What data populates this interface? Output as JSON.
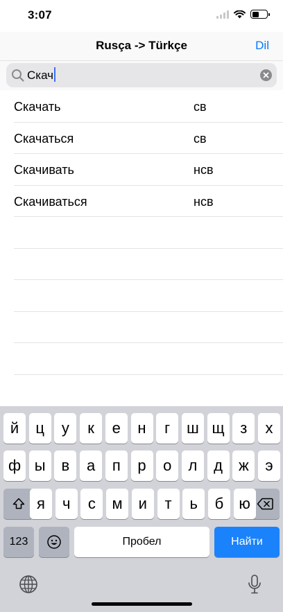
{
  "status_bar": {
    "time": "3:07"
  },
  "nav": {
    "title": "Rusça -> Türkçe",
    "action": "Dil"
  },
  "search": {
    "value": "Скач"
  },
  "results": [
    {
      "word": "Скачать",
      "aspect": "св"
    },
    {
      "word": "Скачаться",
      "aspect": "св"
    },
    {
      "word": "Скачивать",
      "aspect": "нсв"
    },
    {
      "word": "Скачиваться",
      "aspect": "нсв"
    },
    {
      "word": "",
      "aspect": ""
    },
    {
      "word": "",
      "aspect": ""
    },
    {
      "word": "",
      "aspect": ""
    },
    {
      "word": "",
      "aspect": ""
    },
    {
      "word": "",
      "aspect": ""
    }
  ],
  "keyboard": {
    "row1": [
      "й",
      "ц",
      "у",
      "к",
      "е",
      "н",
      "г",
      "ш",
      "щ",
      "з",
      "х"
    ],
    "row2": [
      "ф",
      "ы",
      "в",
      "а",
      "п",
      "р",
      "о",
      "л",
      "д",
      "ж",
      "э"
    ],
    "row3": [
      "я",
      "ч",
      "с",
      "м",
      "и",
      "т",
      "ь",
      "б",
      "ю"
    ],
    "numbers": "123",
    "space": "Пробел",
    "go": "Найти"
  },
  "colors": {
    "accent": "#007aff",
    "go_key": "#1a82fb",
    "keyboard_bg": "#d1d3d9"
  },
  "icons": [
    "search-icon",
    "clear-icon",
    "shift-icon",
    "backspace-icon",
    "emoji-icon",
    "globe-icon",
    "microphone-icon",
    "wifi-icon",
    "battery-icon",
    "signal-icon"
  ]
}
